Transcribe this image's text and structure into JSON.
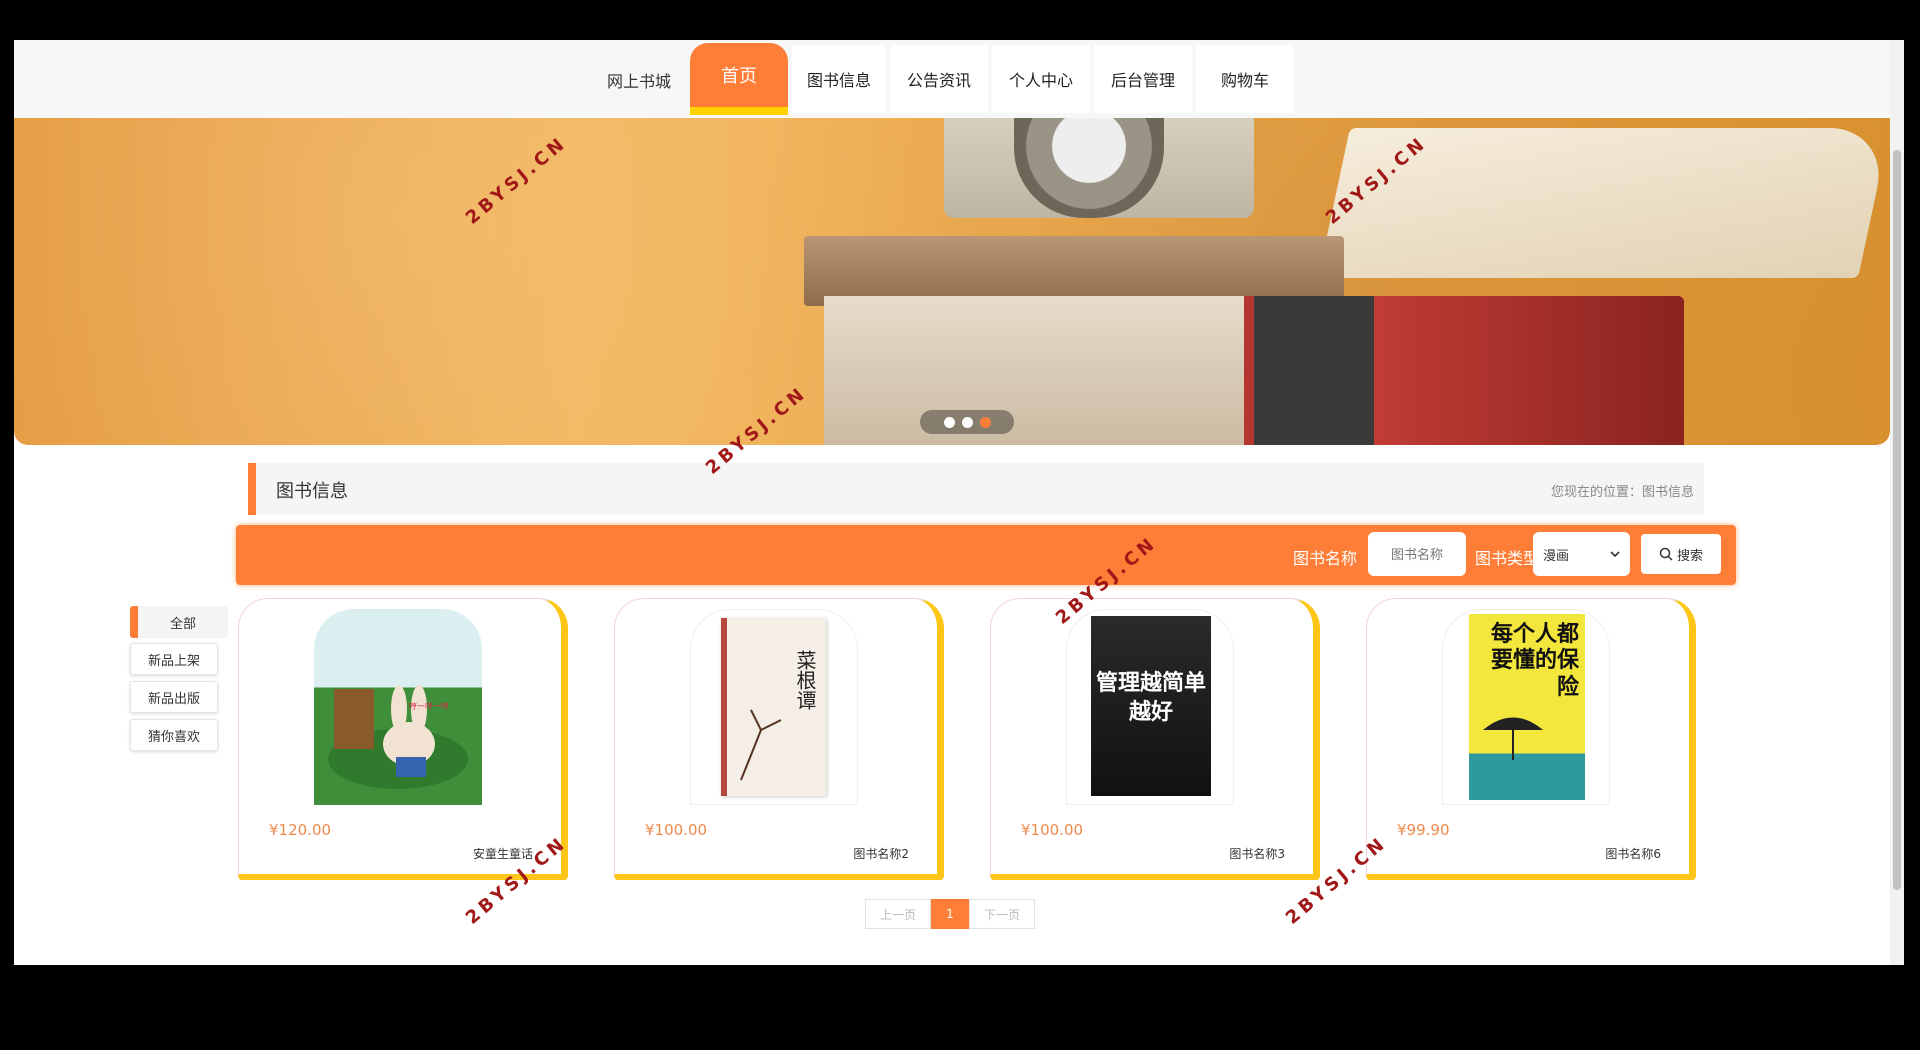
{
  "nav": {
    "site_title": "网上书城",
    "items": [
      {
        "label": "首页",
        "active": true
      },
      {
        "label": "图书信息"
      },
      {
        "label": "公告资讯"
      },
      {
        "label": "个人中心"
      },
      {
        "label": "后台管理"
      },
      {
        "label": "购物车"
      }
    ]
  },
  "banner": {
    "slides": 3,
    "active_slide": 3
  },
  "section": {
    "title": "图书信息",
    "breadcrumb": "您现在的位置：图书信息"
  },
  "search": {
    "name_label": "图书名称",
    "name_placeholder": "图书名称",
    "type_label": "图书类型",
    "type_selected": "漫画",
    "button_label": "搜索"
  },
  "sidebar": {
    "items": [
      {
        "label": "全部",
        "active": true
      },
      {
        "label": "新品上架"
      },
      {
        "label": "新品出版"
      },
      {
        "label": "猜你喜欢"
      }
    ]
  },
  "books": [
    {
      "price": "¥120.00",
      "name": "安童生童话",
      "cover_text": "哼一哼一哼"
    },
    {
      "price": "¥100.00",
      "name": "图书名称2",
      "cover_text": "菜根谭"
    },
    {
      "price": "¥100.00",
      "name": "图书名称3",
      "cover_text": "管理越简单越好"
    },
    {
      "price": "¥99.90",
      "name": "图书名称6",
      "cover_text": "每个人都要懂的保险"
    }
  ],
  "pagination": {
    "prev": "上一页",
    "current": "1",
    "next": "下一页"
  },
  "watermark": "2BYSJ.CN",
  "colors": {
    "accent": "#ff7e37",
    "highlight": "#ffc61a"
  }
}
